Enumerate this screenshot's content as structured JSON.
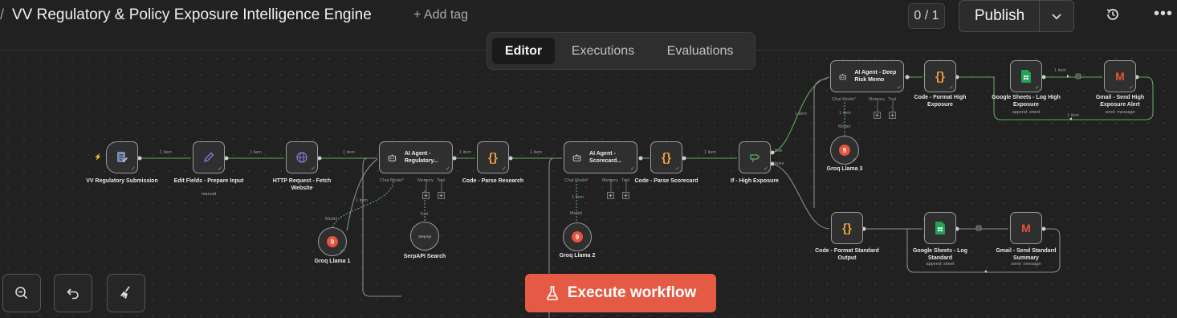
{
  "header": {
    "title": "VV Regulatory & Policy Exposure Intelligence Engine",
    "add_tag": "+ Add tag",
    "counter": "0 / 1",
    "publish": "Publish"
  },
  "tabs": [
    {
      "label": "Editor",
      "active": true
    },
    {
      "label": "Executions",
      "active": false
    },
    {
      "label": "Evaluations",
      "active": false
    }
  ],
  "edge_labels": {
    "item": "1 item",
    "true": "true",
    "false": "false"
  },
  "ports": {
    "chat_model": "Chat Model",
    "required_mark": "*",
    "memory": "Memory",
    "tool": "Tool",
    "model": "Model"
  },
  "nodes": {
    "trigger": {
      "label": "VV Regulatory Submission"
    },
    "edit_fields": {
      "label": "Edit Fields - Prepare Input",
      "sub": "manual"
    },
    "http": {
      "label": "HTTP Request - Fetch Website"
    },
    "agent_research": {
      "label": "AI Agent - Regulatory..."
    },
    "parse_research": {
      "label": "Code - Parse Research"
    },
    "agent_scorecard": {
      "label": "AI Agent - Scorecard..."
    },
    "parse_scorecard": {
      "label": "Code - Parse Scorecard"
    },
    "if_high": {
      "label": "If - High Exposure"
    },
    "agent_deep": {
      "label": "AI Agent - Deep Risk Memo"
    },
    "format_high": {
      "label": "Code - Format High Exposure"
    },
    "sheets_high": {
      "label": "Google Sheets - Log High Exposure",
      "sub": "append: sheet"
    },
    "gmail_high": {
      "label": "Gmail - Send High Exposure Alert",
      "sub": "send: message"
    },
    "groq1": {
      "label": "Groq Llama 1"
    },
    "serpapi": {
      "label": "SerpAPI Search",
      "icon_text": "SerpApi"
    },
    "groq2": {
      "label": "Groq Llama 2"
    },
    "groq3": {
      "label": "Groq Llama 3"
    },
    "format_std": {
      "label": "Code - Format Standard Output"
    },
    "sheets_std": {
      "label": "Google Sheets - Log Standard",
      "sub": "append: sheet"
    },
    "gmail_std": {
      "label": "Gmail - Send Standard Summary",
      "sub": "send: message"
    }
  },
  "icons": {
    "groq": "9",
    "code": "{}",
    "gmail": "M",
    "trigger_bolt": "⚡",
    "check": "✓",
    "plus": "+"
  },
  "execute_button": "Execute workflow",
  "colors": {
    "accent": "#e45a44",
    "success_edge": "#5ea95c",
    "node_border": "#9a9a9a",
    "code_icon": "#f0a33a",
    "groq": "#e5533b",
    "sheets": "#22a355"
  }
}
